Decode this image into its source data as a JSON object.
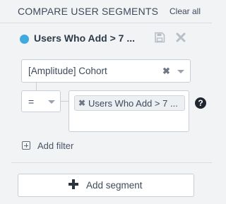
{
  "header": {
    "title": "COMPARE USER SEGMENTS",
    "clear_label": "Clear all"
  },
  "segment": {
    "name": "Users Who Add > 7 ...",
    "dot_color": "#3fa9e0",
    "icons": [
      "save-icon",
      "delete-icon"
    ]
  },
  "filter": {
    "property": "[Amplitude] Cohort",
    "operator": "=",
    "values": [
      "Users Who Add > 7 ..."
    ],
    "clear_glyph": "✖"
  },
  "actions": {
    "help_glyph": "?",
    "add_filter_label": "Add filter",
    "add_segment_label": "Add segment"
  }
}
